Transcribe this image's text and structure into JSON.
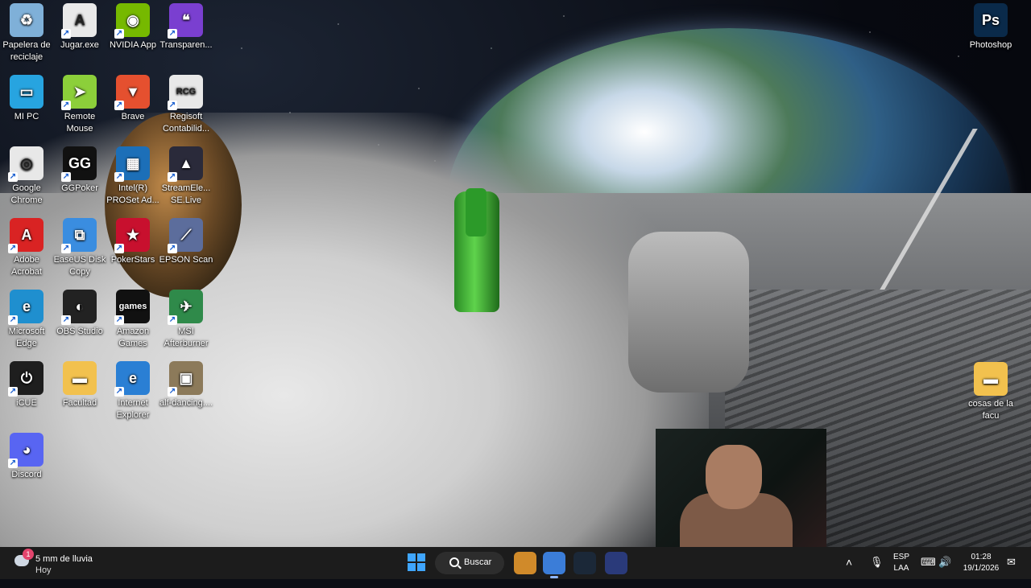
{
  "desktop": {
    "icons": [
      {
        "label": "Papelera de reciclaje",
        "icon": "recycle-bin-icon",
        "color": "#7fb0d8",
        "glyph": "♻"
      },
      {
        "label": "Jugar.exe",
        "icon": "jugar-icon",
        "color": "#e9e9e9",
        "glyph": "A"
      },
      {
        "label": "NVIDIA App",
        "icon": "nvidia-icon",
        "color": "#76b900",
        "glyph": "◉"
      },
      {
        "label": "Transparen...",
        "icon": "chat-bubble-icon",
        "color": "#7a3fd0",
        "glyph": "❝"
      },
      {
        "label": "MI PC",
        "icon": "computer-icon",
        "color": "#27a4e0",
        "glyph": "▭"
      },
      {
        "label": "Remote Mouse",
        "icon": "remote-mouse-icon",
        "color": "#8ccf3a",
        "glyph": "➤"
      },
      {
        "label": "Brave",
        "icon": "brave-icon",
        "color": "#e5502f",
        "glyph": "▼"
      },
      {
        "label": "Regisoft Contabilid...",
        "icon": "regisoft-icon",
        "color": "#e8e8e8",
        "glyph": "RCG"
      },
      {
        "label": "Google Chrome",
        "icon": "chrome-icon",
        "color": "#e8e8e8",
        "glyph": "◎"
      },
      {
        "label": "GGPoker",
        "icon": "ggpoker-icon",
        "color": "#111111",
        "glyph": "GG"
      },
      {
        "label": "Intel(R) PROSet Ad...",
        "icon": "intel-proset-icon",
        "color": "#1c6fb8",
        "glyph": "▦"
      },
      {
        "label": "StreamEle... SE.Live",
        "icon": "streamelements-icon",
        "color": "#2a2a3a",
        "glyph": "▲"
      },
      {
        "label": "Adobe Acrobat",
        "icon": "acrobat-icon",
        "color": "#d92323",
        "glyph": "A"
      },
      {
        "label": "EaseUS Disk Copy",
        "icon": "easeus-icon",
        "color": "#3a8de0",
        "glyph": "⧉"
      },
      {
        "label": "PokerStars",
        "icon": "pokerstars-icon",
        "color": "#c8102e",
        "glyph": "★"
      },
      {
        "label": "EPSON Scan",
        "icon": "epson-scan-icon",
        "color": "#5c6d9c",
        "glyph": "⟋"
      },
      {
        "label": "Microsoft Edge",
        "icon": "edge-icon",
        "color": "#1f8fcf",
        "glyph": "e"
      },
      {
        "label": "OBS Studio",
        "icon": "obs-icon",
        "color": "#222222",
        "glyph": "◐"
      },
      {
        "label": "Amazon Games",
        "icon": "amazon-games-icon",
        "color": "#111111",
        "glyph": "games"
      },
      {
        "label": "MSI Afterburner",
        "icon": "msi-afterburner-icon",
        "color": "#2f8a4a",
        "glyph": "✈"
      },
      {
        "label": "iCUE",
        "icon": "icue-icon",
        "color": "#1e1e1e",
        "glyph": "⏻"
      },
      {
        "label": "Facultad",
        "icon": "folder-icon",
        "color": "#f2c14e",
        "glyph": "▬"
      },
      {
        "label": "Internet Explorer",
        "icon": "internet-explorer-icon",
        "color": "#2a7fd4",
        "glyph": "e"
      },
      {
        "label": "alf-dancing....",
        "icon": "gif-thumbnail-icon",
        "color": "#8c7a5a",
        "glyph": "▣"
      },
      {
        "label": "Discord",
        "icon": "discord-icon",
        "color": "#5865f2",
        "glyph": "◕"
      }
    ],
    "right_icons": [
      {
        "label": "Photoshop",
        "icon": "photoshop-icon",
        "color": "#0a2a4a",
        "glyph": "Ps"
      },
      {
        "label": "cosas de la facu",
        "icon": "folder-icon",
        "color": "#f2c14e",
        "glyph": "▬"
      }
    ]
  },
  "taskbar": {
    "weather_line1": "5 mm de lluvia",
    "weather_line2": "Hoy",
    "weather_badge": "1",
    "search_label": "Buscar",
    "apps": [
      {
        "name": "game-app-icon",
        "color": "#d08a2a"
      },
      {
        "name": "chrome-icon",
        "color": "#3b7dd8"
      },
      {
        "name": "steam-icon",
        "color": "#1b2838"
      },
      {
        "name": "streamelements-icon",
        "color": "#2a3a7a"
      }
    ],
    "language_line1": "ESP",
    "language_line2": "LAA",
    "time": "01:28",
    "date": "19/1/2026"
  }
}
